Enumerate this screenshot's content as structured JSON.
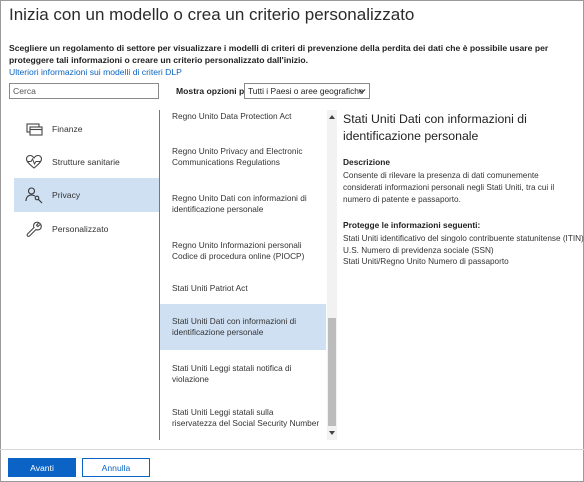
{
  "dialog": {
    "title": "Inizia con un modello o crea un criterio personalizzato",
    "intro": "Scegliere un regolamento di settore per visualizzare i modelli di criteri di prevenzione della perdita dei dati che è possibile usare per proteggere tali informazioni o creare un criterio personalizzato dall'inizio.",
    "learn_more_link": "Ulteriori informazioni sui modelli di criteri DLP"
  },
  "search": {
    "placeholder": "Cerca",
    "value": ""
  },
  "filter": {
    "label": "Mostra opzioni per",
    "selected": "Tutti i Paesi o aree geografiche"
  },
  "categories": [
    {
      "label": "Finanze",
      "icon": "card-icon",
      "selected": false
    },
    {
      "label": "Strutture sanitarie",
      "icon": "heart-pulse-icon",
      "selected": false
    },
    {
      "label": "Privacy",
      "icon": "person-key-icon",
      "selected": true
    },
    {
      "label": "Personalizzato",
      "icon": "wrench-icon",
      "selected": false
    }
  ],
  "regulations": [
    {
      "label": "Regno Unito Data Protection Act",
      "selected": false
    },
    {
      "label": "Regno Unito Privacy and Electronic Communications Regulations",
      "selected": false
    },
    {
      "label": "Regno Unito Dati con informazioni di identificazione personale",
      "selected": false
    },
    {
      "label": "Regno Unito Informazioni personali Codice di procedura online (PIOCP)",
      "selected": false
    },
    {
      "label": "Stati Uniti Patriot Act",
      "selected": false
    },
    {
      "label": "Stati Uniti Dati con informazioni di identificazione personale",
      "selected": true
    },
    {
      "label": "Stati Uniti Leggi statali notifica di violazione",
      "selected": false
    },
    {
      "label": "Stati Uniti Leggi statali sulla riservatezza del Social Security Number",
      "selected": false
    }
  ],
  "details": {
    "title": "Stati Uniti Dati con informazioni di identificazione personale",
    "description_heading": "Descrizione",
    "description": "Consente di rilevare la presenza di dati comunemente considerati informazioni personali negli Stati Uniti, tra cui il numero di patente e passaporto.",
    "protects_heading": "Protegge le informazioni seguenti:",
    "protects": [
      "Stati Uniti identificativo del singolo contribuente statunitense (ITIN)",
      "U.S. Numero di previdenza sociale (SSN)",
      "Stati Uniti/Regno Unito Numero di passaporto"
    ]
  },
  "buttons": {
    "next": "Avanti",
    "cancel": "Annulla"
  },
  "colors": {
    "accent": "#0b63c5",
    "selection": "#cfe0f3",
    "link": "#0a64c2"
  }
}
